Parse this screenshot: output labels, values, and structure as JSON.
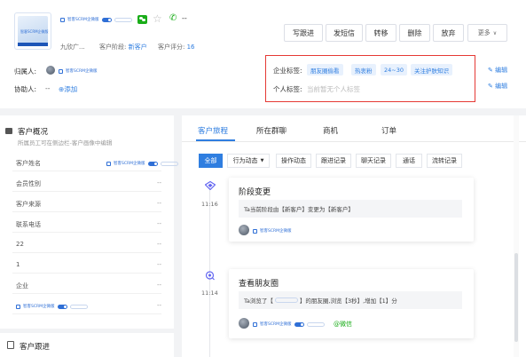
{
  "customer": {
    "avatar_text": "智客SCRM企微版",
    "badge_text": "智客SCRM企微版",
    "phone_value": "--",
    "name": "九欣广...",
    "stage_label": "客户阶段:",
    "stage_value": "新客户",
    "score_label": "客户评分:",
    "score_value": "16"
  },
  "actions": {
    "write_followup": "写跟进",
    "send_sms": "发短信",
    "transfer": "转移",
    "delete": "删除",
    "abandon": "放弃",
    "more": "更多"
  },
  "owner": {
    "label": "归属人:",
    "badge_text": "智客SCRM企微版"
  },
  "assistant": {
    "label": "协助人:",
    "value": "--",
    "add": "添加"
  },
  "tags": {
    "company_label": "企业标签:",
    "company_tags": [
      "朋友圈偷看",
      "热衷粉",
      "24~30",
      "关注护肤知识"
    ],
    "personal_label": "个人标签:",
    "personal_placeholder": "当前暂无个人标签",
    "edit1": "编辑",
    "edit2": "编辑"
  },
  "overview": {
    "title": "客户概况",
    "subtitle": "所属员工可在侧边栏-客户画像中编辑",
    "rows": [
      {
        "label": "客户姓名",
        "value": "",
        "badge": true
      },
      {
        "label": "会员性别",
        "value": "--"
      },
      {
        "label": "客户来源",
        "value": "--"
      },
      {
        "label": "联系电话",
        "value": "--"
      },
      {
        "label": "22",
        "value": "--"
      },
      {
        "label": "1",
        "value": "--"
      },
      {
        "label": "企业",
        "value": "--"
      },
      {
        "label": "",
        "value": "--",
        "badge": true
      }
    ],
    "badge_text": "智客SCRM企微版"
  },
  "followup_section": {
    "title": "客户跟进"
  },
  "tabs": [
    "客户旅程",
    "所在群聊",
    "商机",
    "订单"
  ],
  "filters": [
    "全部",
    "行为动态",
    "操作动态",
    "跟进记录",
    "聊天记录",
    "通话",
    "流转记录"
  ],
  "timeline": [
    {
      "time": "11:16",
      "title": "阶段变更",
      "desc": "Ta当前阶段由【新客户】变更为【新客户】",
      "badge_text": "智客SCRM企微版"
    },
    {
      "time": "11:14",
      "title": "查看朋友圈",
      "desc_prefix": "Ta浏览了【",
      "desc_suffix": "】的朋友圈,浏览【3秒】,增加【1】分",
      "badge_text": "智客SCRM企微版",
      "source": "@微信"
    }
  ],
  "colors": {
    "accent": "#2f7ee0",
    "highlight_box": "#e53935",
    "wechat_green": "#1aad19"
  }
}
